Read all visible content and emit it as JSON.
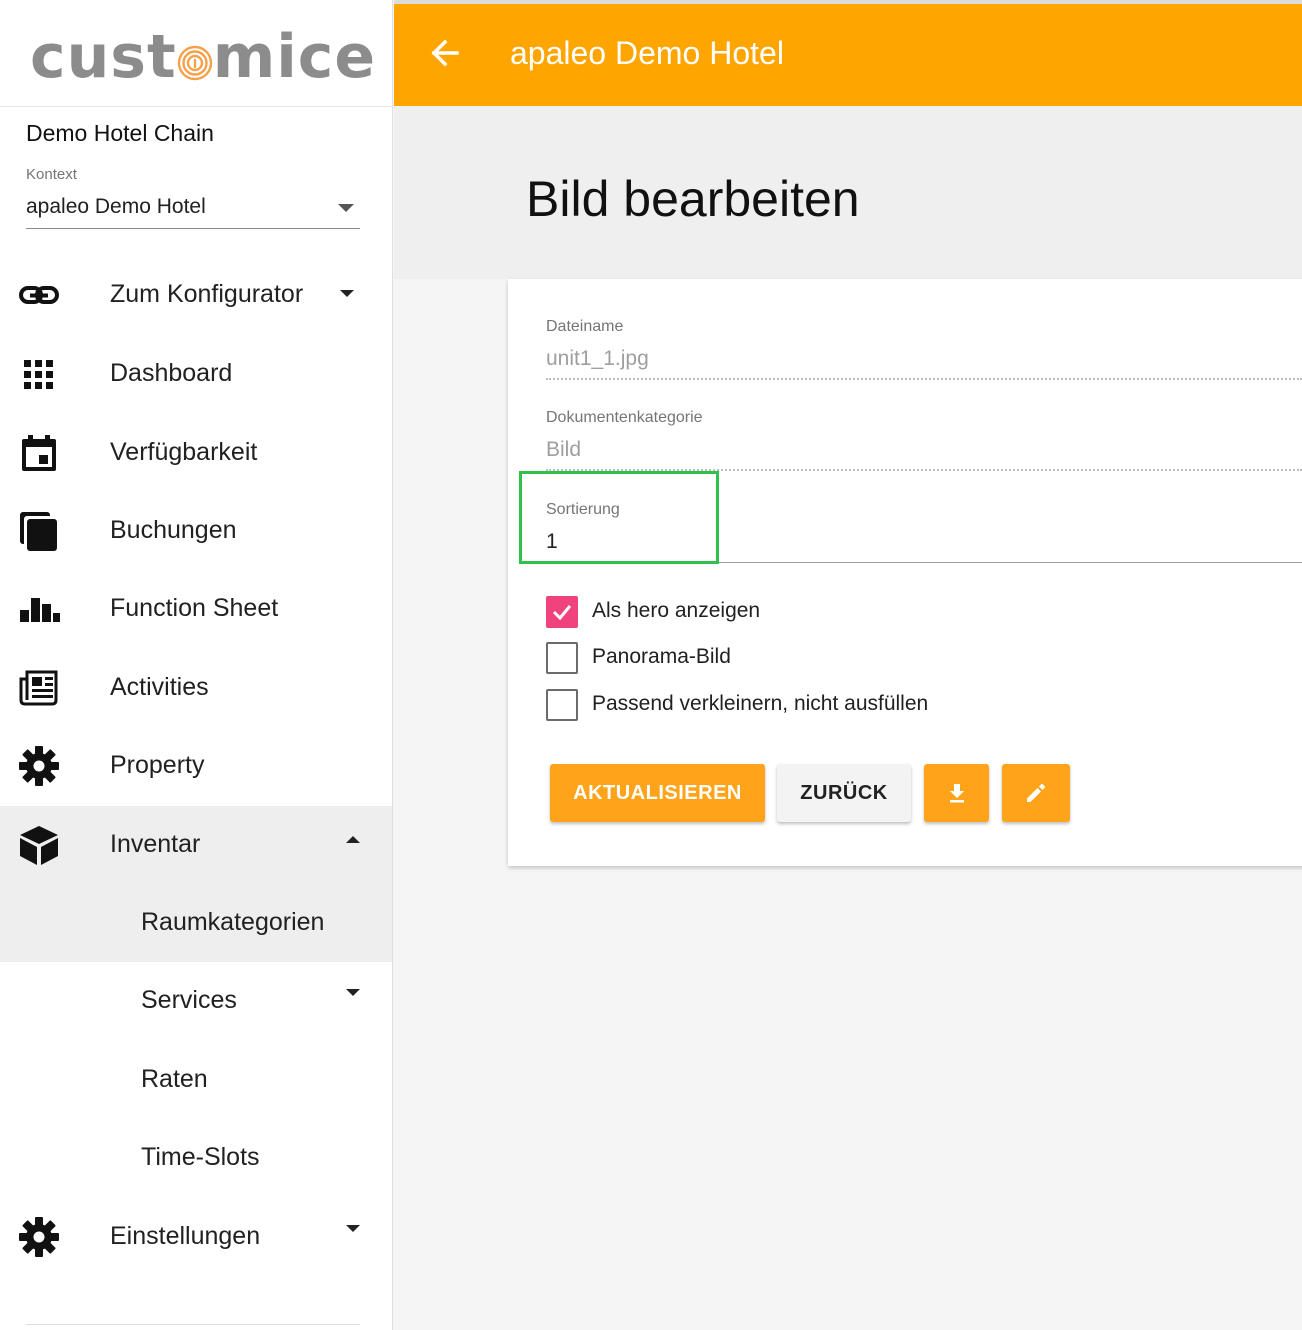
{
  "brand": {
    "logo_text_left": "cust",
    "logo_text_right": "mice",
    "accent_color": "#ffa500",
    "logo_color": "#8c8c8c"
  },
  "sidebar": {
    "chain_name": "Demo Hotel Chain",
    "context_label": "Kontext",
    "context_value": "apaleo Demo Hotel",
    "items": [
      {
        "label": "Zum Konfigurator",
        "icon": "link-icon",
        "caret": "down"
      },
      {
        "label": "Dashboard",
        "icon": "apps-grid-icon"
      },
      {
        "label": "Verfügbarkeit",
        "icon": "calendar-icon"
      },
      {
        "label": "Buchungen",
        "icon": "stacked-pages-icon"
      },
      {
        "label": "Function Sheet",
        "icon": "bar-chart-icon"
      },
      {
        "label": "Activities",
        "icon": "newspaper-icon"
      },
      {
        "label": "Property",
        "icon": "gear-icon"
      },
      {
        "label": "Inventar",
        "icon": "cube-icon",
        "caret": "up",
        "expanded": true
      },
      {
        "label": "Raumkategorien",
        "sub": true,
        "active": true
      },
      {
        "label": "Services",
        "sub": true,
        "caret": "down"
      },
      {
        "label": "Raten",
        "sub": true
      },
      {
        "label": "Time-Slots",
        "sub": true
      },
      {
        "label": "Einstellungen",
        "icon": "gear-icon",
        "caret": "down"
      }
    ]
  },
  "header": {
    "back_icon": "arrow-left-icon",
    "title": "apaleo Demo Hotel"
  },
  "page": {
    "title": "Bild bearbeiten"
  },
  "form": {
    "filename_label": "Dateiname",
    "filename_value": "unit1_1.jpg",
    "category_label": "Dokumentenkategorie",
    "category_value": "Bild",
    "sort_label": "Sortierung",
    "sort_value": "1",
    "checkboxes": [
      {
        "label": "Als hero anzeigen",
        "checked": true
      },
      {
        "label": "Panorama-Bild",
        "checked": false
      },
      {
        "label": "Passend verkleinern, nicht ausfüllen",
        "checked": false
      }
    ],
    "buttons": {
      "update": "AKTUALISIEREN",
      "back": "ZURÜCK",
      "download_icon": "download-icon",
      "edit_icon": "pencil-icon"
    },
    "checkbox_color": "#f0437e",
    "highlight_color": "#2fc14b"
  }
}
